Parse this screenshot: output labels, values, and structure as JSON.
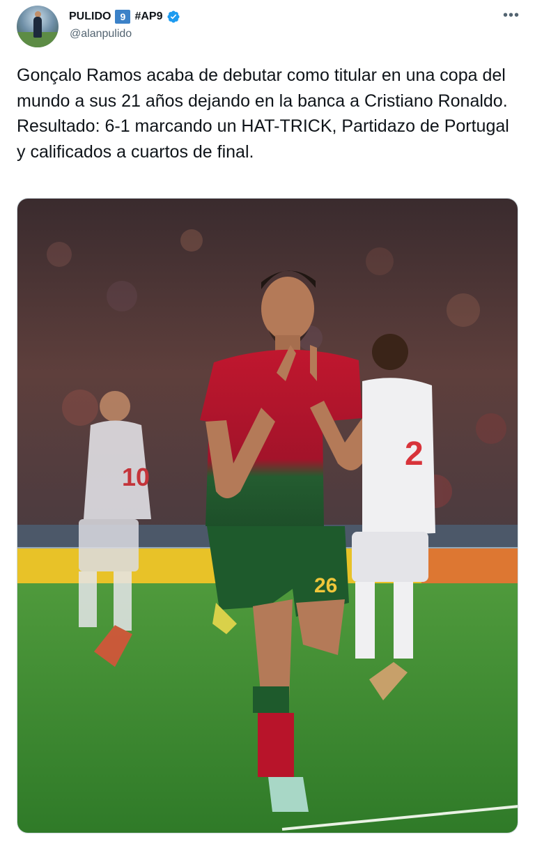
{
  "author": {
    "display_name": "PULIDO",
    "badge_number": "9",
    "name_tag": "#AP9",
    "handle": "@alanpulido",
    "verified": true
  },
  "menu_icon": "more-options-icon",
  "tweet": {
    "text_line_1": "Gonçalo Ramos acaba de debutar como titular en una copa del mundo a sus 21 años dejando en la banca a Cristiano Ronaldo.",
    "text_line_2": "Resultado: 6-1 marcando un HAT-TRICK, Partidazo de Portugal y calificados a cuartos de final."
  },
  "media": {
    "jersey_number_main": "26",
    "jersey_number_right": "2",
    "jersey_number_left": "10",
    "colors": {
      "portugal_red": "#b3142b",
      "portugal_green": "#1f5a2e",
      "pitch": "#3f8a32",
      "board_yellow": "#e8c228",
      "verified_blue": "#1d9bf0"
    }
  }
}
